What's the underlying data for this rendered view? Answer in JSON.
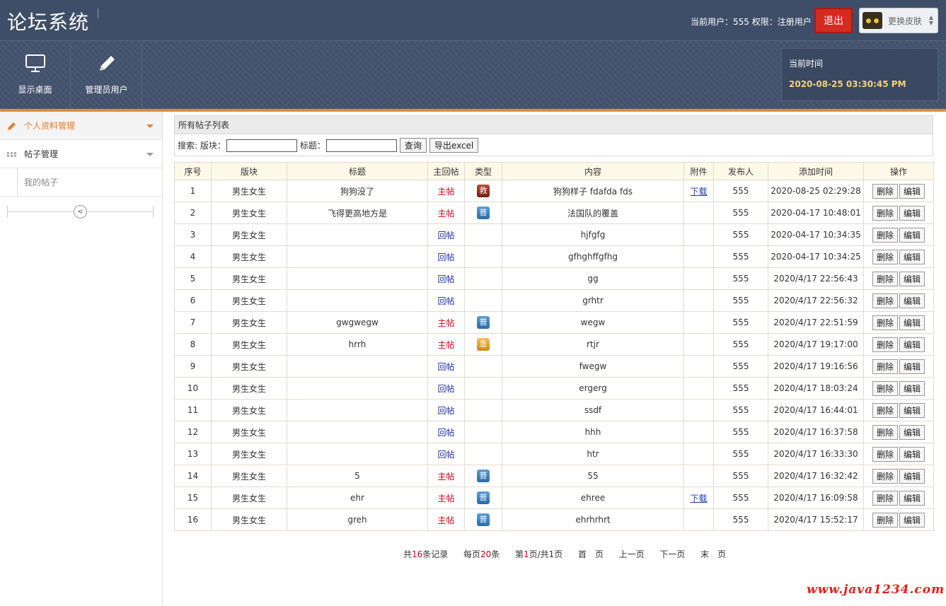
{
  "header": {
    "logo": "论坛系统",
    "user_info": "当前用户：555  权限：注册用户",
    "logout_label": "退出",
    "skin_label": "更换皮肤",
    "nav": [
      {
        "label": "显示桌面",
        "icon": "monitor-icon"
      },
      {
        "label": "管理员用户",
        "icon": "pencil-icon"
      }
    ],
    "time_title": "当前时间",
    "time_value": "2020-08-25 03:30:45 PM"
  },
  "colors": {
    "accent": "#e58a36",
    "header_bg": "#44546f",
    "main_post": "#d0021b",
    "reply_post": "#1d2da0"
  },
  "sidebar": {
    "groups": [
      {
        "label": "个人资料管理",
        "icon": "pencil-icon",
        "active": true
      },
      {
        "label": "帖子管理",
        "icon": "grid-icon",
        "active": false
      }
    ],
    "sub_items": [
      {
        "label": "我的帖子"
      }
    ]
  },
  "panel": {
    "title": "所有帖子列表",
    "search_label": "搜索: 版块：",
    "title_label": "标题：",
    "query_btn": "查询",
    "export_btn": "导出excel"
  },
  "table": {
    "headers": [
      "序号",
      "版块",
      "标题",
      "主回帖",
      "类型",
      "内容",
      "附件",
      "发布人",
      "添加时间",
      "操作"
    ],
    "delete_label": "删除",
    "edit_label": "编辑",
    "rows": [
      {
        "no": "1",
        "board": "男生女生",
        "title": "狗狗没了",
        "kind": "主帖",
        "type": "救",
        "content": "狗狗样子 fdafda fds",
        "attach": "下载",
        "author": "555",
        "time": "2020-08-25 02:29:28"
      },
      {
        "no": "2",
        "board": "男生女生",
        "title": "飞得更高地方是",
        "kind": "主帖",
        "type": "普",
        "content": "法国队的覆盖",
        "attach": "",
        "author": "555",
        "time": "2020-04-17 10:48:01"
      },
      {
        "no": "3",
        "board": "男生女生",
        "title": "",
        "kind": "回帖",
        "type": "",
        "content": "hjfgfg",
        "attach": "",
        "author": "555",
        "time": "2020-04-17 10:34:35"
      },
      {
        "no": "4",
        "board": "男生女生",
        "title": "",
        "kind": "回帖",
        "type": "",
        "content": "gfhghffgfhg",
        "attach": "",
        "author": "555",
        "time": "2020-04-17 10:34:25"
      },
      {
        "no": "5",
        "board": "男生女生",
        "title": "",
        "kind": "回帖",
        "type": "",
        "content": "gg",
        "attach": "",
        "author": "555",
        "time": "2020/4/17 22:56:43"
      },
      {
        "no": "6",
        "board": "男生女生",
        "title": "",
        "kind": "回帖",
        "type": "",
        "content": "grhtr",
        "attach": "",
        "author": "555",
        "time": "2020/4/17 22:56:32"
      },
      {
        "no": "7",
        "board": "男生女生",
        "title": "gwgwegw",
        "kind": "主帖",
        "type": "普",
        "content": "wegw",
        "attach": "",
        "author": "555",
        "time": "2020/4/17 22:51:59"
      },
      {
        "no": "8",
        "board": "男生女生",
        "title": "hrrh",
        "kind": "主帖",
        "type": "急",
        "content": "rtjr",
        "attach": "",
        "author": "555",
        "time": "2020/4/17 19:17:00"
      },
      {
        "no": "9",
        "board": "男生女生",
        "title": "",
        "kind": "回帖",
        "type": "",
        "content": "fwegw",
        "attach": "",
        "author": "555",
        "time": "2020/4/17 19:16:56"
      },
      {
        "no": "10",
        "board": "男生女生",
        "title": "",
        "kind": "回帖",
        "type": "",
        "content": "ergerg",
        "attach": "",
        "author": "555",
        "time": "2020/4/17 18:03:24"
      },
      {
        "no": "11",
        "board": "男生女生",
        "title": "",
        "kind": "回帖",
        "type": "",
        "content": "ssdf",
        "attach": "",
        "author": "555",
        "time": "2020/4/17 16:44:01"
      },
      {
        "no": "12",
        "board": "男生女生",
        "title": "",
        "kind": "回帖",
        "type": "",
        "content": "hhh",
        "attach": "",
        "author": "555",
        "time": "2020/4/17 16:37:58"
      },
      {
        "no": "13",
        "board": "男生女生",
        "title": "",
        "kind": "回帖",
        "type": "",
        "content": "htr",
        "attach": "",
        "author": "555",
        "time": "2020/4/17 16:33:30"
      },
      {
        "no": "14",
        "board": "男生女生",
        "title": "5",
        "kind": "主帖",
        "type": "普",
        "content": "55",
        "attach": "",
        "author": "555",
        "time": "2020/4/17 16:32:42"
      },
      {
        "no": "15",
        "board": "男生女生",
        "title": "ehr",
        "kind": "主帖",
        "type": "普",
        "content": "ehree",
        "attach": "下载",
        "author": "555",
        "time": "2020/4/17 16:09:58"
      },
      {
        "no": "16",
        "board": "男生女生",
        "title": "greh",
        "kind": "主帖",
        "type": "普",
        "content": "ehrhrhrt",
        "attach": "",
        "author": "555",
        "time": "2020/4/17 15:52:17"
      }
    ]
  },
  "pager": {
    "total_pre": "共",
    "total": "16",
    "total_post": "条记录",
    "per_pre": "每页",
    "per": "20",
    "per_post": "条",
    "page_pre": "第",
    "page": "1",
    "page_post": "页/共1页",
    "first": "首　页",
    "prev": "上一页",
    "next": "下一页",
    "last": "末　页"
  },
  "watermark": "www.java1234.com"
}
